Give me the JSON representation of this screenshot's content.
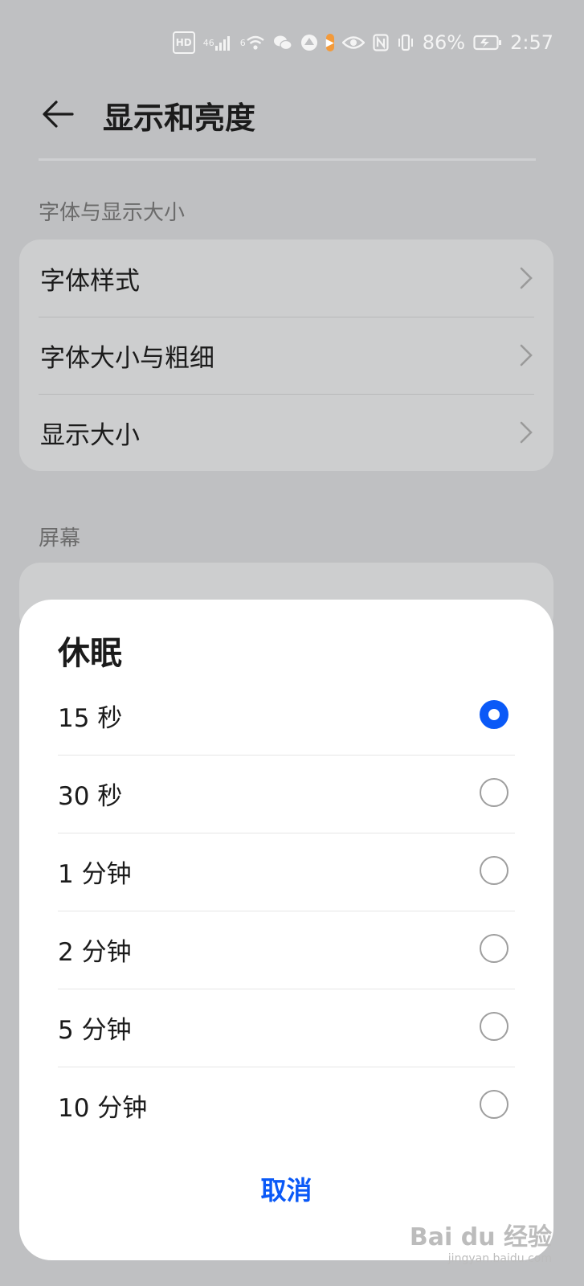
{
  "status_bar": {
    "hd_label": "HD",
    "network_4g": "46",
    "wifi_tag": "6",
    "app_badge": "▶",
    "battery_percent": "86%",
    "time": "2:57"
  },
  "header": {
    "title": "显示和亮度"
  },
  "sections": [
    {
      "label": "字体与显示大小",
      "items": [
        {
          "label": "字体样式"
        },
        {
          "label": "字体大小与粗细"
        },
        {
          "label": "显示大小"
        }
      ]
    },
    {
      "label": "屏幕"
    }
  ],
  "dialog": {
    "title": "休眠",
    "options": [
      {
        "label": "15 秒",
        "selected": true
      },
      {
        "label": "30 秒",
        "selected": false
      },
      {
        "label": "1 分钟",
        "selected": false
      },
      {
        "label": "2 分钟",
        "selected": false
      },
      {
        "label": "5 分钟",
        "selected": false
      },
      {
        "label": "10 分钟",
        "selected": false
      }
    ],
    "cancel_label": "取消"
  },
  "watermark": {
    "main": "Bai du 经验",
    "sub": "jingyan.baidu.com"
  },
  "colors": {
    "accent": "#0a59f7",
    "backdrop": "#bfc0c2"
  }
}
